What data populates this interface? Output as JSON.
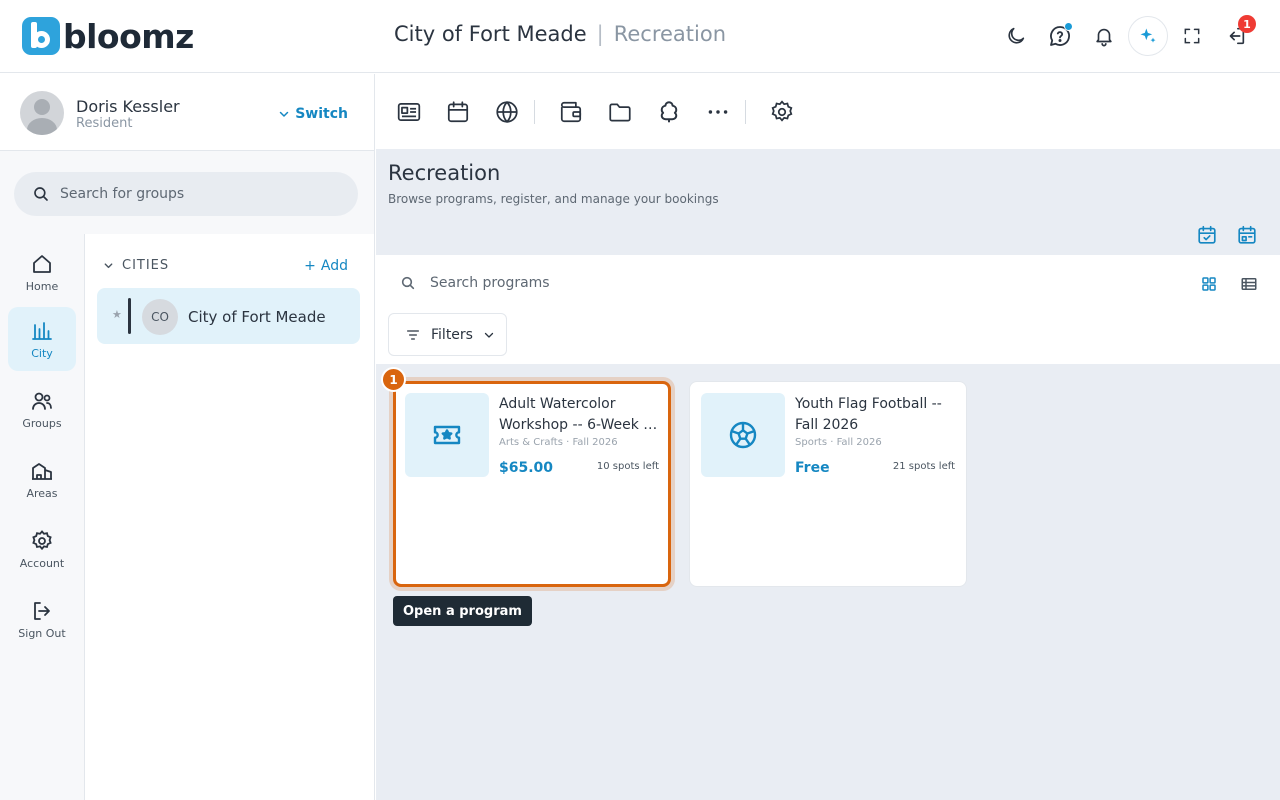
{
  "app": {
    "brand": "bloomz"
  },
  "header": {
    "org": "City of Fort Meade",
    "separator": "|",
    "section": "Recreation",
    "ask_badge": "1"
  },
  "user": {
    "name": "Doris Kessler",
    "role": "Resident",
    "switch_label": "Switch"
  },
  "group_search": {
    "placeholder": "Search for groups"
  },
  "rail": [
    {
      "label": "Home",
      "icon": "home-icon"
    },
    {
      "label": "City",
      "icon": "city-chart-icon"
    },
    {
      "label": "Groups",
      "icon": "groups-icon"
    },
    {
      "label": "Areas",
      "icon": "areas-icon"
    },
    {
      "label": "Account",
      "icon": "gear-icon"
    },
    {
      "label": "Sign Out",
      "icon": "sign-out-icon"
    }
  ],
  "cities": {
    "header": "CITIES",
    "add_label": "Add",
    "items": [
      {
        "initials": "CO",
        "name": "City of Fort Meade"
      }
    ]
  },
  "recreation": {
    "title": "Recreation",
    "subtitle": "Browse programs, register, and manage your bookings",
    "search_placeholder": "Search programs",
    "filters_label": "Filters"
  },
  "programs": [
    {
      "title_line1": "Adult Watercolor",
      "title_line2": "Workshop -- 6-Week S...",
      "meta": "Arts & Crafts · Fall 2026",
      "price": "$65.00",
      "spots": "10 spots left",
      "icon": "ticket-star-icon"
    },
    {
      "title_line1": "Youth Flag Football --",
      "title_line2": "Fall 2026",
      "meta": "Sports · Fall 2026",
      "price": "Free",
      "spots": "21 spots left",
      "icon": "soccer-ball-icon"
    }
  ],
  "guide": {
    "step": "1",
    "tooltip": "Open a program"
  },
  "colors": {
    "accent": "#1587c2",
    "highlight": "#d9650e",
    "badge": "#ef3b34"
  }
}
